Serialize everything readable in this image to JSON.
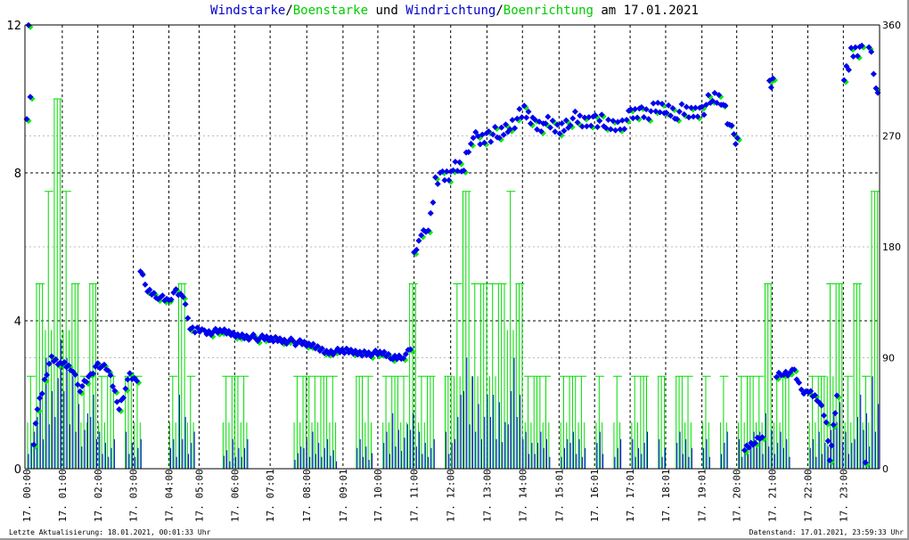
{
  "chart_data": {
    "type": "bar+scatter",
    "title_parts": [
      "Windstarke",
      "/",
      "Boenstarke",
      " und ",
      "Windrichtung",
      "/",
      "Boenrichtung",
      " am 17.01.2021"
    ],
    "colors": {
      "speed": "#0000ff",
      "gust": "#00dd00",
      "direction": "#0000ee",
      "gust_direction": "#00ee00"
    },
    "ylim_left": [
      0,
      12
    ],
    "yticks_left": [
      "0",
      "4",
      "8",
      "12"
    ],
    "ylim_right": [
      0,
      360
    ],
    "yticks_right": [
      "0",
      "90",
      "180",
      "270",
      "360"
    ],
    "x_range_hours": [
      0,
      24
    ],
    "xticks": [
      {
        "h": 0,
        "label": "17. 00:00"
      },
      {
        "h": 1,
        "label": "17. 01:00"
      },
      {
        "h": 2,
        "label": "17. 02:00"
      },
      {
        "h": 3,
        "label": "17. 03:00"
      },
      {
        "h": 4,
        "label": "17. 04:00"
      },
      {
        "h": 4.85,
        "label": "17. 05:00"
      },
      {
        "h": 5.85,
        "label": "17. 06:00"
      },
      {
        "h": 6.85,
        "label": "17. 07:01"
      },
      {
        "h": 7.88,
        "label": "17. 08:00"
      },
      {
        "h": 8.9,
        "label": "17. 09:01"
      },
      {
        "h": 9.88,
        "label": "17. 10:00"
      },
      {
        "h": 10.9,
        "label": "17. 11:00"
      },
      {
        "h": 11.93,
        "label": "17. 12:00"
      },
      {
        "h": 12.95,
        "label": "17. 13:00"
      },
      {
        "h": 13.95,
        "label": "17. 14:00"
      },
      {
        "h": 14.98,
        "label": "17. 15:01"
      },
      {
        "h": 15.98,
        "label": "17. 16:01"
      },
      {
        "h": 16.98,
        "label": "17. 17:01"
      },
      {
        "h": 17.98,
        "label": "17. 18:01"
      },
      {
        "h": 19,
        "label": "17. 19:01"
      },
      {
        "h": 19.98,
        "label": "17. 20:00"
      },
      {
        "h": 20.98,
        "label": "17. 21:00"
      },
      {
        "h": 21.98,
        "label": "17. 22:00"
      },
      {
        "h": 22.98,
        "label": "17. 23:00"
      }
    ],
    "gust_per_15min": [
      2.5,
      5,
      7.5,
      10,
      7.5,
      5,
      2.5,
      5,
      2.5,
      2.5,
      0,
      2.5,
      2.5,
      0,
      0,
      0,
      2.5,
      5,
      2.5,
      0,
      0,
      0,
      2.5,
      2.5,
      2.5,
      0,
      0,
      0,
      0,
      0,
      2.5,
      2.5,
      2.5,
      2.5,
      2.5,
      0,
      0,
      2.5,
      2.5,
      0,
      2.5,
      2.5,
      2.5,
      5,
      2.5,
      2.5,
      0,
      2.5,
      5,
      7.5,
      5,
      5,
      5,
      5,
      7.5,
      5,
      2.5,
      2.5,
      2.5,
      0,
      2.5,
      2.5,
      2.5,
      0,
      2.5,
      0,
      2.5,
      0,
      2.5,
      2.5,
      0,
      2.5,
      0,
      2.5,
      2.5,
      0,
      2.5,
      0,
      2.5,
      0,
      2.5,
      2.5,
      2.5,
      5,
      2.5,
      2.5,
      0,
      0,
      2.5,
      2.5,
      5,
      5,
      2.5,
      5,
      2.5,
      7.5
    ],
    "speed_per_15min": [
      1,
      2,
      3,
      3.5,
      3,
      2.5,
      1.5,
      2,
      1,
      0.8,
      0,
      1,
      0.8,
      0,
      0,
      0,
      0.8,
      2,
      1,
      0,
      0,
      0,
      0.5,
      0.8,
      0.8,
      0,
      0,
      0,
      0,
      0,
      0.6,
      0.8,
      1,
      0.8,
      0.5,
      0,
      0,
      0.8,
      0.6,
      0,
      1,
      1.5,
      1.2,
      1.5,
      1,
      0.8,
      0,
      1,
      2,
      3,
      2.5,
      2,
      2,
      1.8,
      3,
      2,
      1,
      1,
      0.8,
      0,
      0.8,
      1,
      0.8,
      0,
      1,
      0,
      0.8,
      0,
      0.8,
      1,
      0,
      0.8,
      0,
      1,
      0.8,
      0,
      0.8,
      0,
      1,
      0,
      0.8,
      1,
      1,
      1.5,
      1,
      0.8,
      0,
      0,
      0.8,
      1,
      1.5,
      1.8,
      1,
      2,
      1.5,
      2.5
    ],
    "direction": [
      [
        0,
        290
      ],
      [
        0.05,
        355
      ],
      [
        0.1,
        300
      ],
      [
        0.2,
        20
      ],
      [
        0.3,
        50
      ],
      [
        0.5,
        70
      ],
      [
        0.7,
        90
      ],
      [
        1,
        85
      ],
      [
        1.3,
        80
      ],
      [
        1.5,
        65
      ],
      [
        1.8,
        75
      ],
      [
        2,
        85
      ],
      [
        2.3,
        80
      ],
      [
        2.6,
        50
      ],
      [
        2.9,
        75
      ],
      [
        3.1,
        70
      ],
      [
        3.2,
        160
      ],
      [
        3.4,
        145
      ],
      [
        3.7,
        140
      ],
      [
        4,
        135
      ],
      [
        4.2,
        145
      ],
      [
        4.4,
        140
      ],
      [
        4.6,
        115
      ],
      [
        4.8,
        112
      ],
      [
        5,
        111
      ],
      [
        5.5,
        111
      ],
      [
        6,
        108
      ],
      [
        6.5,
        106
      ],
      [
        7,
        105
      ],
      [
        7.5,
        103
      ],
      [
        8,
        100
      ],
      [
        8.5,
        95
      ],
      [
        9,
        95
      ],
      [
        9.5,
        94
      ],
      [
        10,
        93
      ],
      [
        10.3,
        90
      ],
      [
        10.6,
        92
      ],
      [
        10.8,
        95
      ],
      [
        10.9,
        175
      ],
      [
        11.1,
        190
      ],
      [
        11.3,
        195
      ],
      [
        11.5,
        230
      ],
      [
        11.7,
        238
      ],
      [
        12,
        242
      ],
      [
        12.3,
        245
      ],
      [
        12.5,
        270
      ],
      [
        12.7,
        265
      ],
      [
        13,
        272
      ],
      [
        13.3,
        270
      ],
      [
        13.6,
        280
      ],
      [
        14,
        288
      ],
      [
        14.3,
        280
      ],
      [
        14.6,
        280
      ],
      [
        15,
        275
      ],
      [
        15.3,
        285
      ],
      [
        15.7,
        280
      ],
      [
        16,
        285
      ],
      [
        16.3,
        278
      ],
      [
        16.7,
        280
      ],
      [
        17,
        285
      ],
      [
        17.3,
        290
      ],
      [
        17.7,
        290
      ],
      [
        18,
        292
      ],
      [
        18.3,
        290
      ],
      [
        18.7,
        288
      ],
      [
        19,
        292
      ],
      [
        19.3,
        300
      ],
      [
        19.6,
        300
      ],
      [
        19.9,
        265
      ],
      [
        20,
        265
      ],
      [
        20.2,
        15
      ],
      [
        20.5,
        22
      ],
      [
        20.7,
        28
      ],
      [
        20.9,
        310
      ],
      [
        21,
        315
      ],
      [
        21.1,
        75
      ],
      [
        21.3,
        78
      ],
      [
        21.6,
        78
      ],
      [
        21.8,
        63
      ],
      [
        22,
        62
      ],
      [
        22.3,
        55
      ],
      [
        22.5,
        40
      ],
      [
        22.6,
        5
      ],
      [
        22.7,
        35
      ],
      [
        22.8,
        60
      ],
      [
        23,
        320
      ],
      [
        23.2,
        335
      ],
      [
        23.5,
        340
      ],
      [
        23.6,
        5
      ],
      [
        23.7,
        345
      ],
      [
        23.9,
        315
      ],
      [
        24,
        295
      ]
    ]
  },
  "footer": {
    "last_update": "Letzte Aktualisierung: 18.01.2021, 00:01:33 Uhr",
    "data_state": "Datenstand: 17.01.2021, 23:59:33 Uhr"
  }
}
